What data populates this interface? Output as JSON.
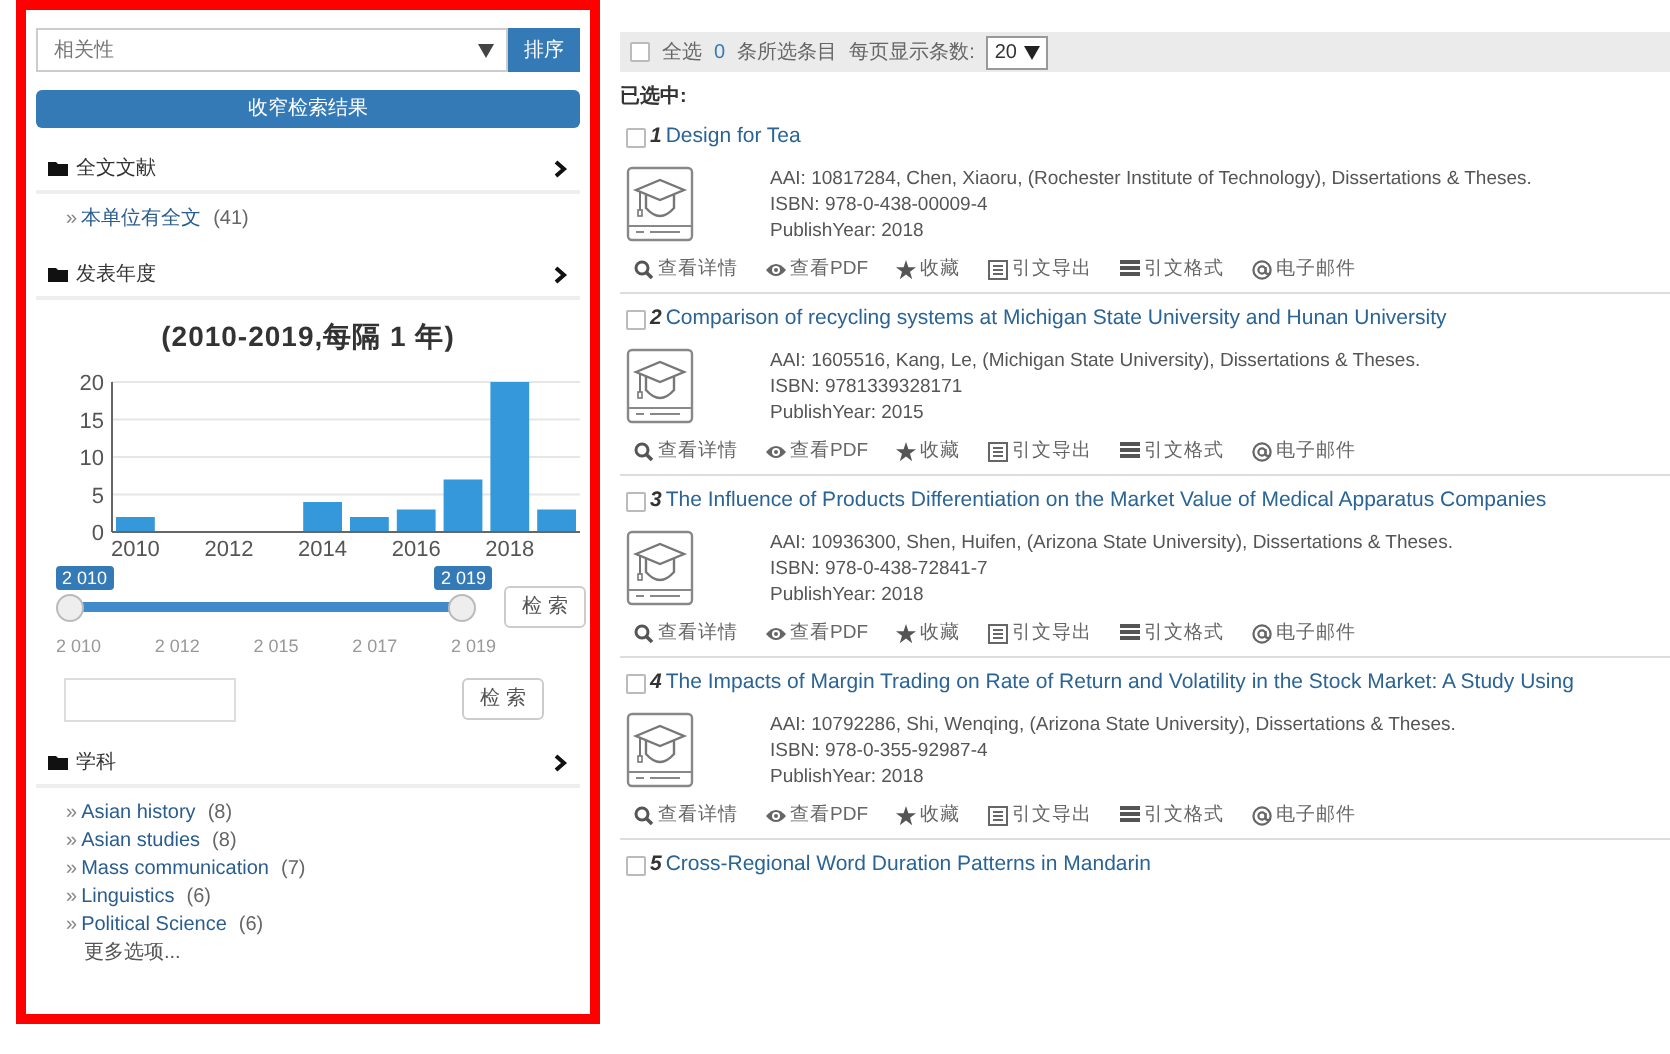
{
  "sort": {
    "value": "相关性",
    "button": "排序"
  },
  "narrow_button": "收窄检索结果",
  "facets": [
    {
      "kind": "list",
      "title": "全文文献",
      "items": [
        {
          "bullet": "»",
          "label": "本单位有全文",
          "count": "(41)"
        }
      ]
    },
    {
      "kind": "years",
      "title": "发表年度",
      "chart_data": {
        "type": "bar",
        "title": "(2010-2019,每隔 1 年)",
        "x": [
          2010,
          2011,
          2012,
          2013,
          2014,
          2015,
          2016,
          2017,
          2018,
          2019
        ],
        "series": [
          {
            "color": "#3498db",
            "values": [
              2,
              0,
              0,
              0,
              4,
              2,
              3,
              7,
              20,
              3
            ]
          }
        ],
        "ylim": [
          0,
          20
        ],
        "yticks": [
          0,
          5,
          10,
          15,
          20
        ],
        "xlim": [
          2009.5,
          2019.5
        ],
        "xticks": [
          2010,
          2012,
          2014,
          2016,
          2018
        ],
        "grid": true
      },
      "slider": {
        "from_label": "2 010",
        "to_label": "2 019",
        "level": 1,
        "scale": [
          "2 010",
          "2 012",
          "2 015",
          "2 017",
          "2 019"
        ],
        "button": "检 索"
      },
      "input_button": "检 索"
    },
    {
      "kind": "list",
      "title": "学科",
      "items": [
        {
          "bullet": "»",
          "label": "Asian history",
          "count": "(8)"
        },
        {
          "bullet": "»",
          "label": "Asian studies",
          "count": "(8)"
        },
        {
          "bullet": "»",
          "label": "Mass communication",
          "count": "(7)"
        },
        {
          "bullet": "»",
          "label": "Linguistics",
          "count": "(6)"
        },
        {
          "bullet": "»",
          "label": "Political Science",
          "count": "(6)"
        }
      ],
      "more": "更多选项..."
    }
  ],
  "toolbar": {
    "select_all_label": "全选",
    "checked": false,
    "count": "0",
    "count_label": "条所选条目",
    "per_page_label": "每页显示条数:",
    "per_page": "20"
  },
  "selected_label": "已选中:",
  "results": [
    {
      "number": "1",
      "title": "Design for Tea",
      "checked": false,
      "lines": [
        "AAI: 10817284, Chen, Xiaoru, (Rochester Institute of Technology), Dissertations & Theses.",
        "ISBN: 978-0-438-00009-4",
        "PublishYear: 2018"
      ],
      "actions": [
        {
          "kind": "search",
          "label": "查看详情"
        },
        {
          "kind": "eye",
          "label": "查看PDF"
        },
        {
          "kind": "star",
          "label": "收藏"
        },
        {
          "kind": "export",
          "label": "引文导出"
        },
        {
          "kind": "format",
          "label": "引文格式"
        },
        {
          "kind": "email",
          "label": "电子邮件"
        }
      ]
    },
    {
      "number": "2",
      "title": "Comparison of recycling systems at Michigan State University and Hunan University",
      "checked": false,
      "lines": [
        "AAI: 1605516, Kang, Le, (Michigan State University), Dissertations & Theses.",
        "ISBN: 9781339328171",
        "PublishYear: 2015"
      ],
      "actions": [
        {
          "kind": "search",
          "label": "查看详情"
        },
        {
          "kind": "eye",
          "label": "查看PDF"
        },
        {
          "kind": "star",
          "label": "收藏"
        },
        {
          "kind": "export",
          "label": "引文导出"
        },
        {
          "kind": "format",
          "label": "引文格式"
        },
        {
          "kind": "email",
          "label": "电子邮件"
        }
      ]
    },
    {
      "number": "3",
      "title": "The Influence of Products Differentiation on the Market Value of Medical Apparatus Companies",
      "checked": false,
      "lines": [
        "AAI: 10936300, Shen, Huifen, (Arizona State University), Dissertations & Theses.",
        "ISBN: 978-0-438-72841-7",
        "PublishYear: 2018"
      ],
      "actions": [
        {
          "kind": "search",
          "label": "查看详情"
        },
        {
          "kind": "eye",
          "label": "查看PDF"
        },
        {
          "kind": "star",
          "label": "收藏"
        },
        {
          "kind": "export",
          "label": "引文导出"
        },
        {
          "kind": "format",
          "label": "引文格式"
        },
        {
          "kind": "email",
          "label": "电子邮件"
        }
      ]
    },
    {
      "number": "4",
      "title": "The Impacts of Margin Trading on Rate of Return and Volatility in the Stock Market: A Study Using",
      "checked": false,
      "lines": [
        "AAI: 10792286, Shi, Wenqing, (Arizona State University), Dissertations & Theses.",
        "ISBN: 978-0-355-92987-4",
        "PublishYear: 2018"
      ],
      "actions": [
        {
          "kind": "search",
          "label": "查看详情"
        },
        {
          "kind": "eye",
          "label": "查看PDF"
        },
        {
          "kind": "star",
          "label": "收藏"
        },
        {
          "kind": "export",
          "label": "引文导出"
        },
        {
          "kind": "format",
          "label": "引文格式"
        },
        {
          "kind": "email",
          "label": "电子邮件"
        }
      ]
    },
    {
      "number": "5",
      "title": "Cross-Regional Word Duration Patterns in Mandarin",
      "checked": false
    }
  ]
}
